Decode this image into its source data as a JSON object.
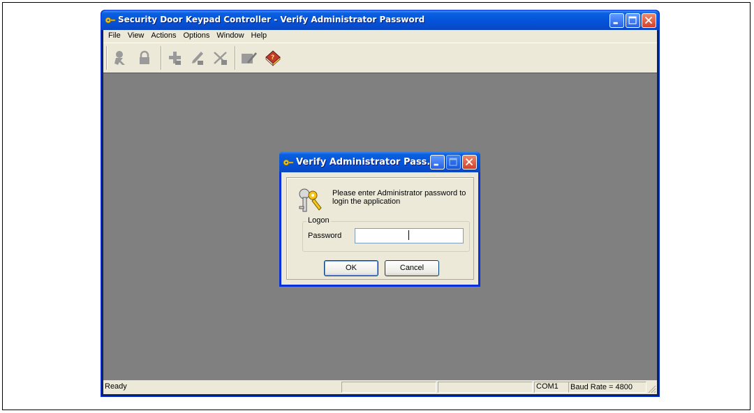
{
  "main_window": {
    "title": "Security Door Keypad Controller - Verify Administrator Password",
    "menu": [
      "File",
      "View",
      "Actions",
      "Options",
      "Window",
      "Help"
    ],
    "toolbar_icons": [
      "user-icon",
      "lock-icon",
      "add-icon",
      "edit-icon",
      "delete-icon",
      "keypad-icon",
      "help-book-icon"
    ]
  },
  "status": {
    "ready": "Ready",
    "port": "COM1",
    "baud": "Baud Rate = 4800"
  },
  "dialog": {
    "title": "Verify Administrator Pass...",
    "prompt": "Please enter Administrator password to login the application",
    "group_label": "Logon",
    "password_label": "Password",
    "password_value": "",
    "ok_label": "OK",
    "cancel_label": "Cancel"
  },
  "colors": {
    "title_blue": "#0452d8",
    "mdi_background": "#808080",
    "face": "#ece9d8"
  }
}
